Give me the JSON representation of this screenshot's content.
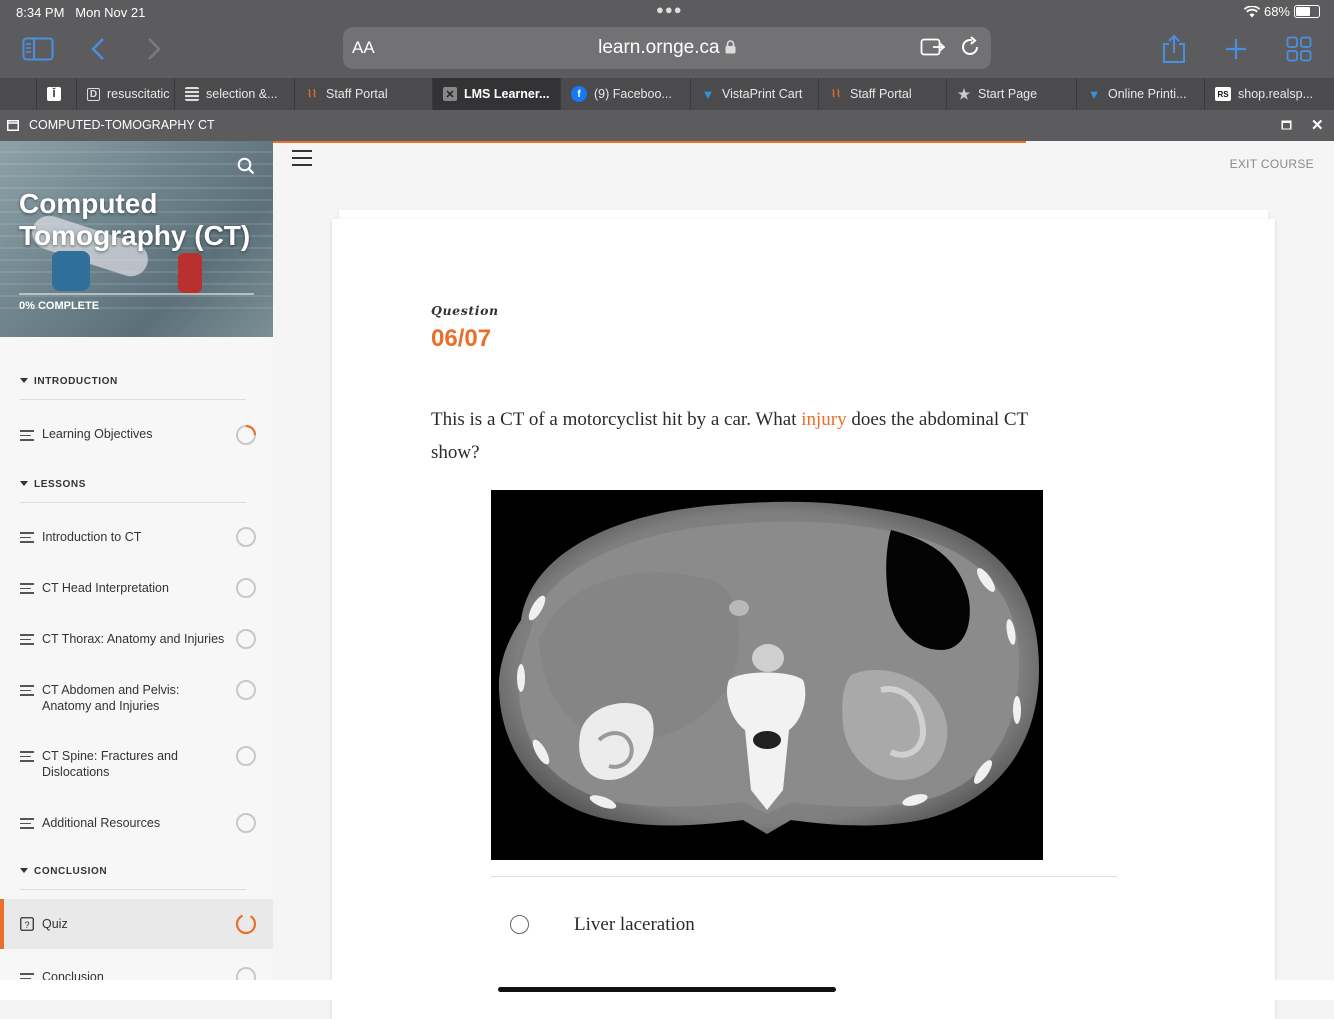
{
  "status": {
    "time": "8:34 PM",
    "date": "Mon Nov 21",
    "battery": "68%",
    "battery_level": 0.68
  },
  "browser": {
    "text_size": "AA",
    "url": "learn.ornge.ca",
    "tabs": [
      {
        "label": "",
        "icon": "ocr-icon",
        "active": false
      },
      {
        "label": "resuscitatic",
        "icon": "d-logo-icon",
        "active": false
      },
      {
        "label": "selection &...",
        "icon": "site-logo-icon",
        "active": false
      },
      {
        "label": "Staff Portal",
        "icon": "ornge-logo-icon",
        "active": false
      },
      {
        "label": "LMS Learner...",
        "icon": "close-icon",
        "active": true
      },
      {
        "label": "(9) Faceboo...",
        "icon": "facebook-icon",
        "active": false
      },
      {
        "label": "VistaPrint Cart",
        "icon": "vistaprint-icon",
        "active": false
      },
      {
        "label": "Staff Portal",
        "icon": "ornge-logo-icon",
        "active": false
      },
      {
        "label": "Start Page",
        "icon": "star-icon",
        "active": false
      },
      {
        "label": "Online Printi...",
        "icon": "vistaprint-icon",
        "active": false
      },
      {
        "label": "shop.realsp...",
        "icon": "realsp-logo-icon",
        "active": false
      }
    ]
  },
  "app": {
    "window_title": "COMPUTED-TOMOGRAPHY CT"
  },
  "sidebar": {
    "course_title": "Computed Tomography (CT)",
    "progress_text": "0% COMPLETE",
    "sections": {
      "introduction": "INTRODUCTION",
      "lessons": "LESSONS",
      "conclusion": "CONCLUSION"
    },
    "items": {
      "learning_objectives": "Learning Objectives",
      "intro_ct": "Introduction to CT",
      "ct_head": "CT Head Interpretation",
      "ct_thorax": "CT Thorax: Anatomy and Injuries",
      "ct_abdomen_1": "CT Abdomen and Pelvis:",
      "ct_abdomen_2": "Anatomy and Injuries",
      "ct_spine_1": "CT Spine: Fractures and",
      "ct_spine_2": "Dislocations",
      "additional": "Additional Resources",
      "quiz": "Quiz",
      "conclusion": "Conclusion"
    }
  },
  "main": {
    "exit_label": "EXIT COURSE",
    "course_progress": 0.71,
    "question_label": "Question",
    "question_number": "06/07",
    "question_text_before": "This is a CT of a motorcyclist hit by a car. What ",
    "question_highlight": "injury",
    "question_text_after": " does the abdominal CT show?",
    "option_1": "Liver laceration"
  },
  "colors": {
    "accent": "#e8702a",
    "chrome": "#5c5c5e",
    "link_blue": "#4a90e2"
  }
}
